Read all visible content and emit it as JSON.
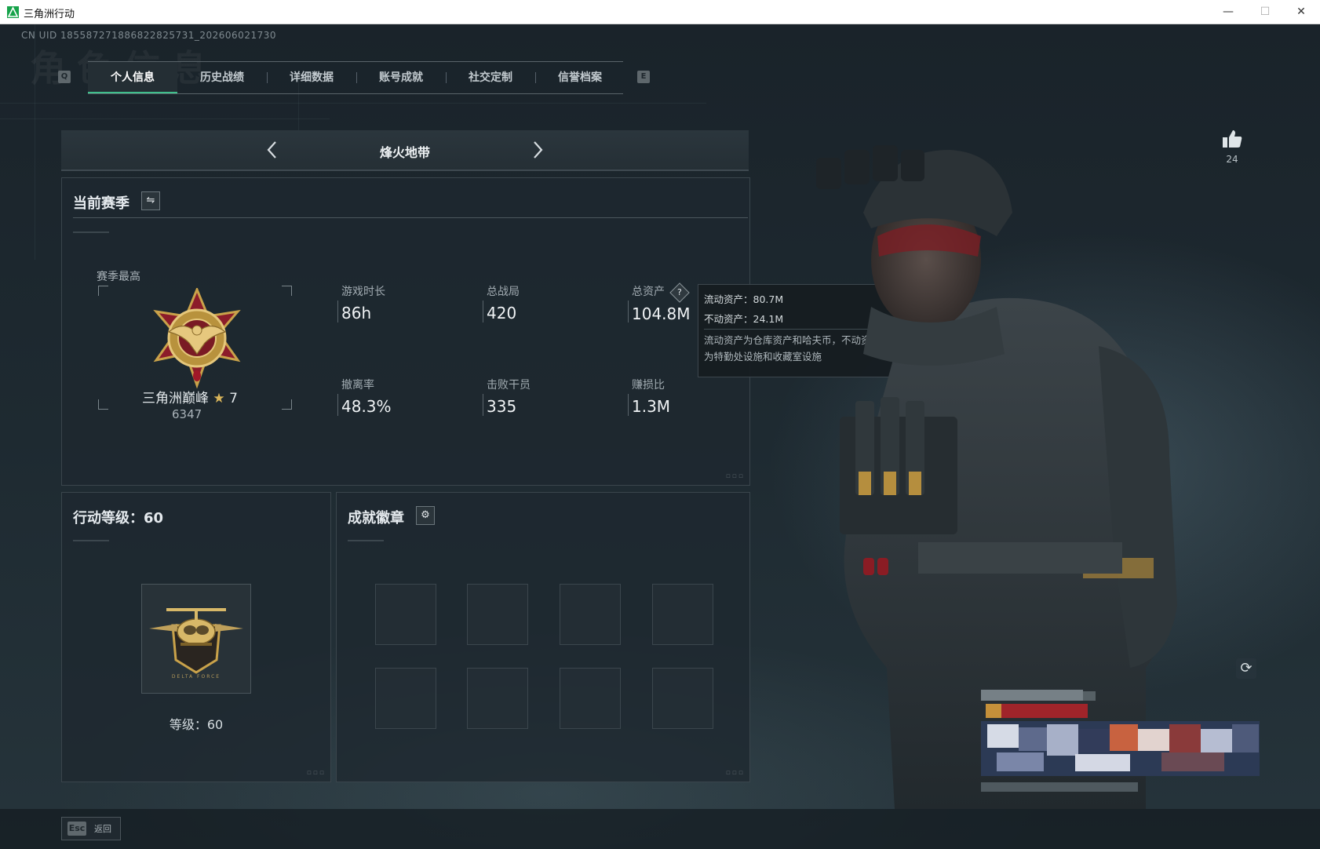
{
  "window": {
    "title": "三角洲行动"
  },
  "uid": "CN UID 185587271886822825731_202606021730",
  "watermark": "角色信息",
  "tabs": {
    "left_key": "Q",
    "right_key": "E",
    "items": [
      {
        "label": "个人信息",
        "active": true
      },
      {
        "label": "历史战绩",
        "active": false
      },
      {
        "label": "详细数据",
        "active": false
      },
      {
        "label": "账号成就",
        "active": false
      },
      {
        "label": "社交定制",
        "active": false
      },
      {
        "label": "信誉档案",
        "active": false
      }
    ]
  },
  "mode_selector": {
    "title": "烽火地带",
    "prev_icon": "chevron-left-icon",
    "next_icon": "chevron-right-icon"
  },
  "season": {
    "title": "当前赛季",
    "best_label": "赛季最高",
    "rank_name": "三角洲巅峰",
    "rank_stars": "7",
    "rank_score": "6347",
    "stats": [
      {
        "label": "游戏时长",
        "value": "86h"
      },
      {
        "label": "总战局",
        "value": "420"
      },
      {
        "label": "总资产",
        "value": "104.8M"
      },
      {
        "label": "撤离率",
        "value": "48.3%"
      },
      {
        "label": "击败干员",
        "value": "335"
      },
      {
        "label": "赚损比",
        "value": "1.3M"
      }
    ]
  },
  "assets_tooltip": {
    "liquid": "流动资产：80.7M",
    "fixed": "不动资产：24.1M",
    "note_line1": "流动资产为仓库资产和哈夫币，不动资产",
    "note_line2": "为特勤处设施和收藏室设施"
  },
  "operation_level": {
    "title": "行动等级：60",
    "level_text": "等级：60",
    "badge_text": "DELTA FORCE"
  },
  "achievements": {
    "title": "成就徽章",
    "slots": 8
  },
  "likes": {
    "count": "24"
  },
  "footer": {
    "esc_key": "Esc",
    "esc_label": "返回"
  },
  "colors": {
    "accent": "#3fbf8c",
    "gold": "#c9a24a",
    "crimson": "#8c1c2a"
  }
}
